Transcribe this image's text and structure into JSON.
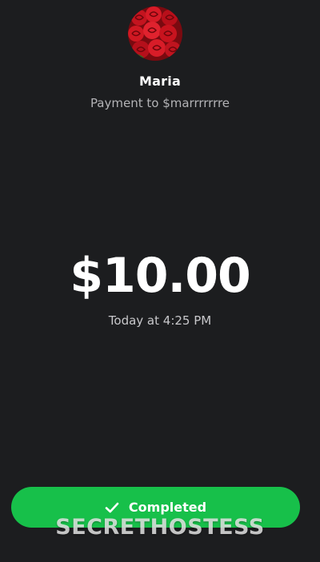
{
  "recipient": {
    "name": "Maria",
    "payment_to": "Payment to $marrrrrrre",
    "avatar_icon": "rose-bouquet-avatar"
  },
  "transaction": {
    "amount": "$10.00",
    "timestamp": "Today at 4:25 PM"
  },
  "status": {
    "label": "Completed",
    "icon": "check-icon",
    "color": "#17c04a"
  },
  "watermark": {
    "text": "SECRETHOSTESS"
  },
  "colors": {
    "background": "#1c1d1f",
    "accent": "#17c04a"
  }
}
